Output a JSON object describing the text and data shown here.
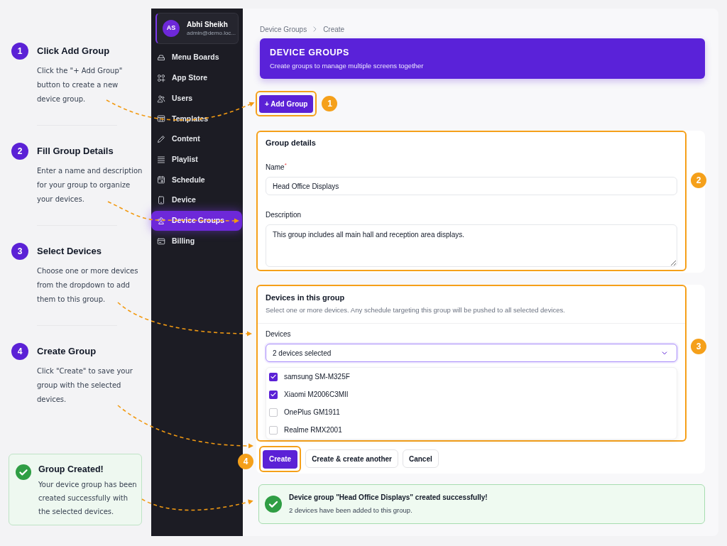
{
  "guide": {
    "steps": [
      {
        "number": "1",
        "title": "Click Add Group",
        "description": "Click the \"+ Add Group\" button to create a new device group."
      },
      {
        "number": "2",
        "title": "Fill Group Details",
        "description": "Enter a name and description for your group to organize your devices."
      },
      {
        "number": "3",
        "title": "Select Devices",
        "description": "Choose one or more devices from the dropdown to add them to this group."
      },
      {
        "number": "4",
        "title": "Create Group",
        "description": "Click \"Create\" to save your group with the selected devices."
      }
    ],
    "result": {
      "title": "Group Created!",
      "description": "Your device group has been created successfully with the selected devices."
    }
  },
  "sidebar": {
    "user": {
      "initials": "AS",
      "name": "Abhi Sheikh",
      "email": "admin@demo.loc..."
    },
    "items": [
      {
        "label": "Menu Boards",
        "selected": false
      },
      {
        "label": "App Store",
        "selected": false
      },
      {
        "label": "Users",
        "selected": false
      },
      {
        "label": "Templates",
        "selected": false
      },
      {
        "label": "Content",
        "selected": false
      },
      {
        "label": "Playlist",
        "selected": false
      },
      {
        "label": "Schedule",
        "selected": false
      },
      {
        "label": "Device",
        "selected": false
      },
      {
        "label": "Device Groups",
        "selected": true
      },
      {
        "label": "Billing",
        "selected": false
      }
    ]
  },
  "breadcrumb": [
    "Device Groups",
    "Create"
  ],
  "header": {
    "title": "DEVICE GROUPS",
    "subtitle": "Create groups to manage multiple screens together"
  },
  "add_button": {
    "label": "+ Add Group",
    "highlighted": true,
    "callout": "1"
  },
  "group_details": {
    "title": "Group details",
    "highlighted": true,
    "callout": "2",
    "name": {
      "label": "Name$^{*}$",
      "value": "Head Office Displays"
    },
    "description": {
      "label": "Description",
      "value": "This group includes all main hall and reception area displays."
    }
  },
  "devices": {
    "title": "Devices in this group",
    "subtitle": "Select one or more devices. Any schedule targeting this group will be pushed to all selected devices.",
    "highlighted": true,
    "callout": "3",
    "field_label": "Devices",
    "value": "2 devices selected",
    "expanded": true,
    "options": [
      {
        "label": "samsung SM-M325F",
        "checked": true
      },
      {
        "label": "Xiaomi M2006C3MII",
        "checked": true
      },
      {
        "label": "OnePlus GM1911",
        "checked": false
      },
      {
        "label": "Realme RMX2001",
        "checked": false
      }
    ]
  },
  "actions": {
    "callout": "4",
    "buttons": [
      {
        "label": "Create",
        "kind": "primary",
        "highlighted": true
      },
      {
        "label": "Create & create another",
        "kind": "secondary",
        "highlighted": false
      },
      {
        "label": "Cancel",
        "kind": "secondary",
        "highlighted": false
      }
    ]
  },
  "alert": {
    "title": "Device group \"Head Office Displays\" created successfully!",
    "message": "2 devices have been added to this group."
  }
}
